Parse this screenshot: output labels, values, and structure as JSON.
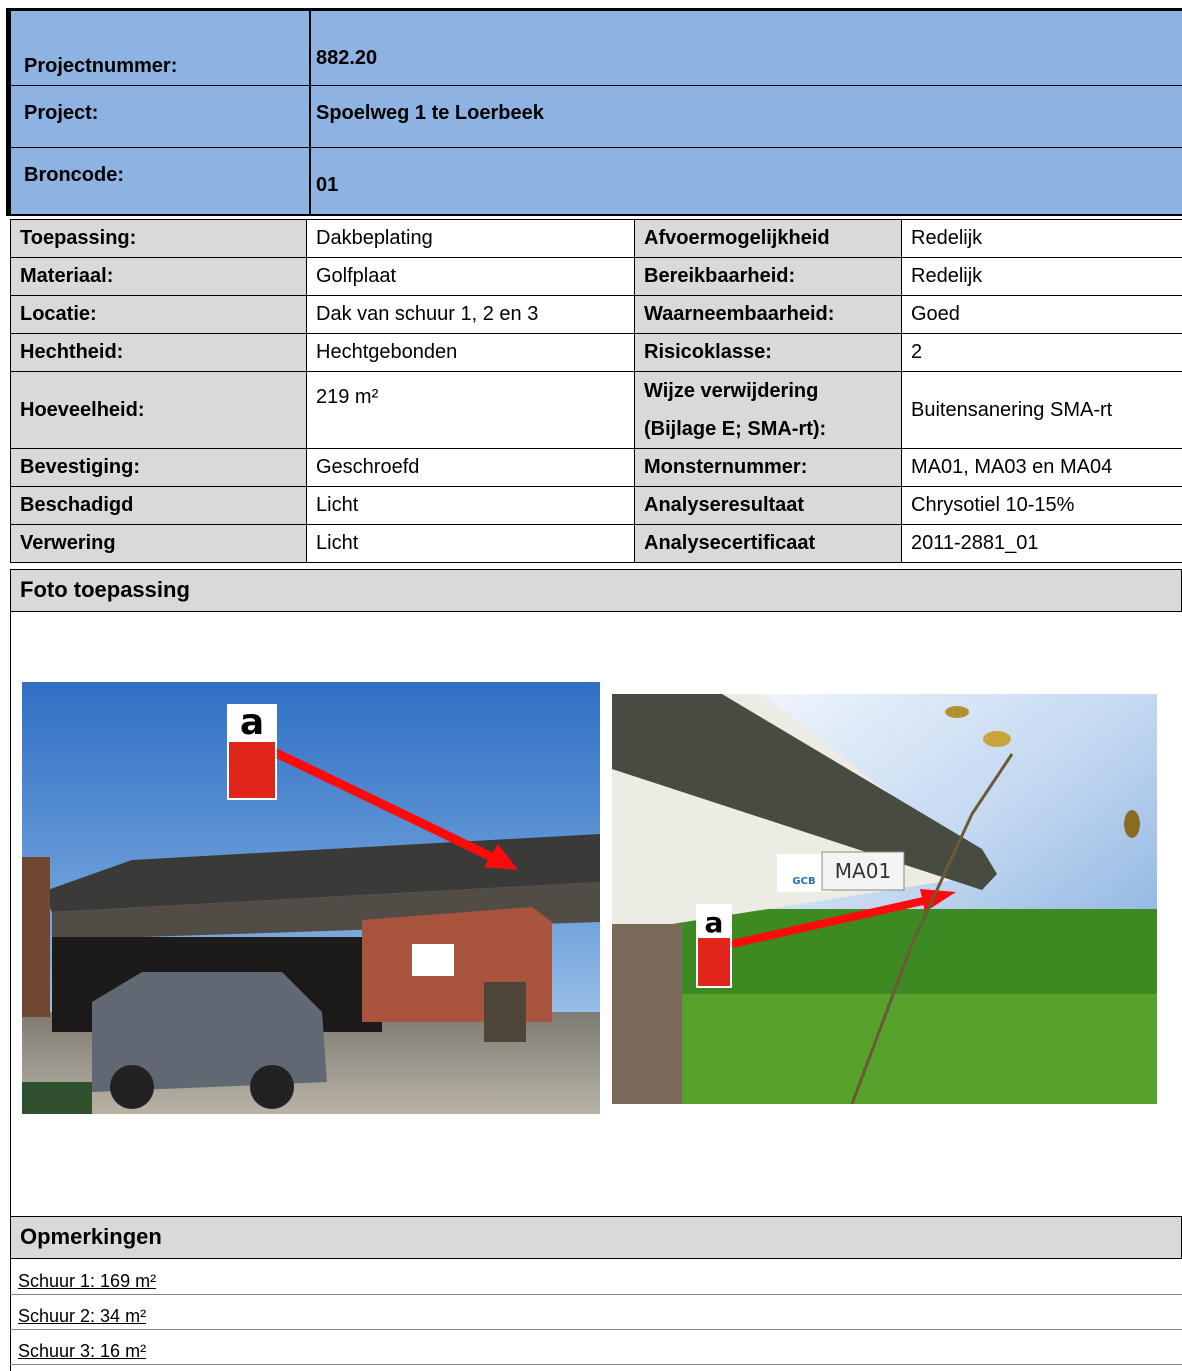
{
  "header": {
    "rows": [
      {
        "label": "Projectnummer:",
        "value": "882.20"
      },
      {
        "label": "Project:",
        "value": "Spoelweg 1 te Loerbeek"
      },
      {
        "label": "Broncode:",
        "value": "01"
      }
    ]
  },
  "info": [
    {
      "l1": "Toepassing:",
      "v1": "Dakbeplating",
      "l2": "Afvoermogelijkheid",
      "v2": "Redelijk"
    },
    {
      "l1": "Materiaal:",
      "v1": "Golfplaat",
      "l2": "Bereikbaarheid:",
      "v2": "Redelijk"
    },
    {
      "l1": "Locatie:",
      "v1": "Dak van schuur 1, 2 en 3",
      "l2": "Waarneembaarheid:",
      "v2": "Goed"
    },
    {
      "l1": "Hechtheid:",
      "v1": "Hechtgebonden",
      "l2": "Risicoklasse:",
      "v2": "2"
    },
    {
      "l1": "Hoeveelheid:",
      "v1": "219 m²",
      "l2a": "Wijze verwijdering",
      "l2b": "(Bijlage E; SMA-rt):",
      "v2": "Buitensanering SMA-rt"
    },
    {
      "l1": "Bevestiging:",
      "v1": "Geschroefd",
      "l2": "Monsternummer:",
      "v2": "MA01, MA03 en MA04"
    },
    {
      "l1": "Beschadigd",
      "v1": "Licht",
      "l2": "Analyseresultaat",
      "v2": "Chrysotiel 10-15%"
    },
    {
      "l1": "Verwering",
      "v1": "Licht",
      "l2": "Analysecertificaat",
      "v2": "2011-2881_01"
    }
  ],
  "photo_section": {
    "title": "Foto toepassing",
    "label_text": "MA01",
    "logo_text": "GCB"
  },
  "remarks": {
    "title": "Opmerkingen",
    "lines": [
      "Schuur 1: 169 m²",
      "Schuur 2: 34 m²",
      "Schuur 3: 16 m²"
    ]
  }
}
